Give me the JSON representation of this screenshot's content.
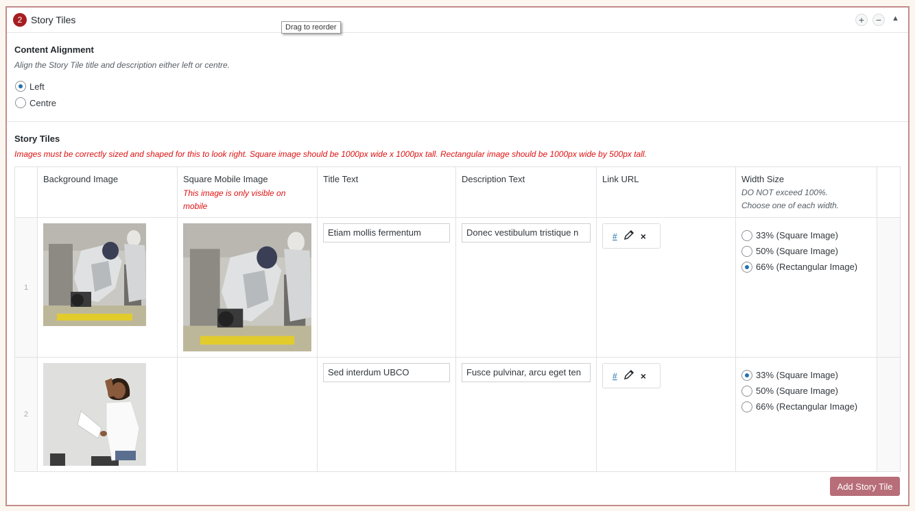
{
  "panel": {
    "number": "2",
    "title": "Story Tiles",
    "tooltip": "Drag to reorder",
    "add_glyph": "+",
    "remove_glyph": "−",
    "collapse_glyph": "▲"
  },
  "content_alignment": {
    "label": "Content Alignment",
    "description": "Align the Story Tile title and description either left or centre.",
    "options": [
      {
        "label": "Left",
        "checked": true
      },
      {
        "label": "Centre",
        "checked": false
      }
    ]
  },
  "story_tiles": {
    "label": "Story Tiles",
    "instructions": "Images must be correctly sized and shaped for this to look right. Square image should be 1000px wide x 1000px tall. Rectangular image should be 1000px wide by 500px tall.",
    "columns": {
      "background_image": "Background Image",
      "square_mobile_image": "Square Mobile Image",
      "square_mobile_note": "This image is only visible on mobile",
      "title_text": "Title Text",
      "description_text": "Description Text",
      "link_url": "Link URL",
      "width_size": "Width Size",
      "width_note_1": "DO NOT exceed 100%.",
      "width_note_2": "Choose one of each width."
    },
    "rows": [
      {
        "num": "1",
        "title": "Etiam mollis fermentum",
        "description": "Donec vestibulum tristique n",
        "link_hash": "#",
        "width_options": [
          {
            "label": "33% (Square Image)",
            "checked": false
          },
          {
            "label": "50% (Square Image)",
            "checked": false
          },
          {
            "label": "66% (Rectangular Image)",
            "checked": true
          }
        ]
      },
      {
        "num": "2",
        "title": "Sed interdum UBCO",
        "description": "Fusce pulvinar, arcu eget ten",
        "link_hash": "#",
        "width_options": [
          {
            "label": "33% (Square Image)",
            "checked": true
          },
          {
            "label": "50% (Square Image)",
            "checked": false
          },
          {
            "label": "66% (Rectangular Image)",
            "checked": false
          }
        ]
      }
    ],
    "add_button": "Add Story Tile",
    "remove_glyph": "×"
  },
  "colors": {
    "badge": "#a61e22",
    "panel_border": "#c48b8b",
    "warning": "#dd1111",
    "radio_accent": "#2271b1",
    "add_button": "#b76e79"
  }
}
